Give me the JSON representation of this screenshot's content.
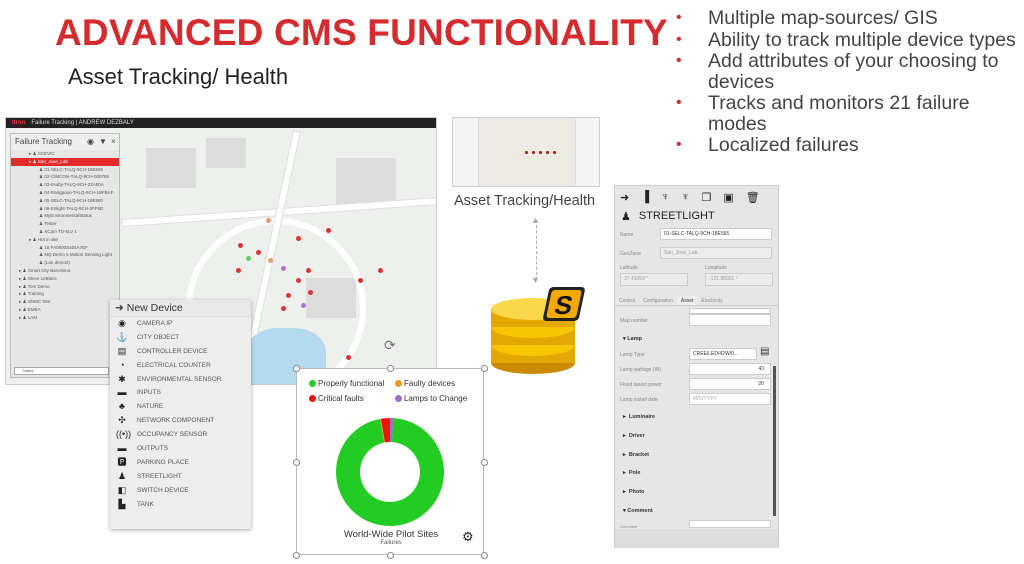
{
  "slide": {
    "title": "ADVANCED CMS FUNCTIONALITY",
    "subtitle": "Asset Tracking/ Health",
    "accent": "#d52b2e"
  },
  "bullets": [
    "Multiple map-sources/ GIS",
    "Ability to track multiple device types",
    "Add attributes of your choosing to devices",
    "Tracks and monitors 21 failure modes",
    "Localized failures"
  ],
  "map_app": {
    "brand": "Itron",
    "app_name": "Failure Tracking",
    "user": "ANDREW DEZBALY",
    "panel_title": "Failure Tracking",
    "search_placeholder": "Name",
    "tree": [
      {
        "label": "SCEVIC",
        "level": 1,
        "selected": false
      },
      {
        "label": "San_Jose_Lab",
        "level": 1,
        "selected": true
      },
      {
        "label": "01-SELC-TALQ-9CH-18E565",
        "level": 2
      },
      {
        "label": "02-CIMCON-TALQ-9CH-000765",
        "level": 2
      },
      {
        "label": "03-Itsuby-TALQ-9CH-22A80A",
        "level": 2
      },
      {
        "label": "04-Rangpoon-TALQ-9CH-1BFBAF",
        "level": 2
      },
      {
        "label": "05-SELC-TALQ-9CH-18E580",
        "level": 2
      },
      {
        "label": "06-Enlight-TALQ-9CH-2FF6D",
        "level": 2
      },
      {
        "label": "MyEnvironmentalStatus",
        "level": 2
      },
      {
        "label": "Tester",
        "level": 2
      },
      {
        "label": "XCam TD-5LV 1",
        "level": 2
      },
      {
        "label": "Hot in site",
        "level": 1
      },
      {
        "label": "16 FA0000S404A7EF",
        "level": 2
      },
      {
        "label": "MQ Demo 5 Motion Sensing Light",
        "level": 2
      },
      {
        "label": "(Lan demo2)",
        "level": 2
      },
      {
        "label": "Smart City Barcelona",
        "level": 0
      },
      {
        "label": "Steve LeBlanc",
        "level": 0
      },
      {
        "label": "Tom Demo",
        "level": 0
      },
      {
        "label": "Training",
        "level": 0
      },
      {
        "label": "SNMC Test",
        "level": 0
      },
      {
        "label": "EMEA",
        "level": 0
      },
      {
        "label": "LAM",
        "level": 0
      }
    ]
  },
  "new_device": {
    "title": "New Device",
    "items": [
      {
        "label": "CAMERA IP",
        "icon": "camera"
      },
      {
        "label": "CITY OBJECT",
        "icon": "anchor"
      },
      {
        "label": "CONTROLLER DEVICE",
        "icon": "controller"
      },
      {
        "label": "ELECTRICAL COUNTER",
        "icon": "meter"
      },
      {
        "label": "ENVIRONMENTAL SENSOR",
        "icon": "bug"
      },
      {
        "label": "INPUTS",
        "icon": "inputs"
      },
      {
        "label": "NATURE",
        "icon": "tree"
      },
      {
        "label": "NETWORK COMPONENT",
        "icon": "network"
      },
      {
        "label": "OCCUPANCY SENSOR",
        "icon": "radar"
      },
      {
        "label": "OUTPUTS",
        "icon": "outputs"
      },
      {
        "label": "PARKING PLACE",
        "icon": "parking"
      },
      {
        "label": "STREETLIGHT",
        "icon": "bulb"
      },
      {
        "label": "SWITCH DEVICE",
        "icon": "switch"
      },
      {
        "label": "TANK",
        "icon": "fuel"
      }
    ]
  },
  "chart_data": {
    "type": "pie",
    "donut": true,
    "title": "World-Wide Pilot Sites",
    "subtitle": "Failures",
    "legend_placement": "top",
    "series": [
      {
        "name": "Properly functional",
        "value": 96,
        "color": "#22cc22"
      },
      {
        "name": "Faulty devices",
        "value": 0.3,
        "color": "#f39a1e"
      },
      {
        "name": "Critical faults",
        "value": 2.7,
        "color": "#ee1111"
      },
      {
        "name": "Lamps to Change",
        "value": 1,
        "color": "#9b6fc9"
      }
    ]
  },
  "thumbnail": {
    "caption": "Asset Tracking/Health"
  },
  "streetlight": {
    "title": "STREETLIGHT",
    "fields": {
      "name_label": "Name",
      "name": "01-SELC-TALQ-9CH-18E565",
      "geozone_label": "GeoZone",
      "geozone": "San_Jose_Lab",
      "lat_label": "Latitude",
      "lat": "37.41059 °",
      "lon_label": "Longitude",
      "lon": "-121.95021 °"
    },
    "tabs": [
      "Control",
      "Configuration",
      "Asset",
      "Electricity"
    ],
    "active_tab": "Asset",
    "map_number_label": "Map number",
    "lamp_section": "Lamp",
    "lamp_type_label": "Lamp Type",
    "lamp_type": "CREE/LED/42W/0...",
    "lamp_wattage_label": "Lamp wattage (W)",
    "lamp_wattage": "43",
    "fixed_power_label": "Fixed saved power",
    "fixed_power": "20",
    "install_date_label": "Lamp install date",
    "install_date_placeholder": "M/D/YYYY",
    "sections": [
      "Luminaire",
      "Driver",
      "Bracket",
      "Pole",
      "Photo"
    ],
    "comment_section": "Comment",
    "comment_label": "Comment"
  }
}
